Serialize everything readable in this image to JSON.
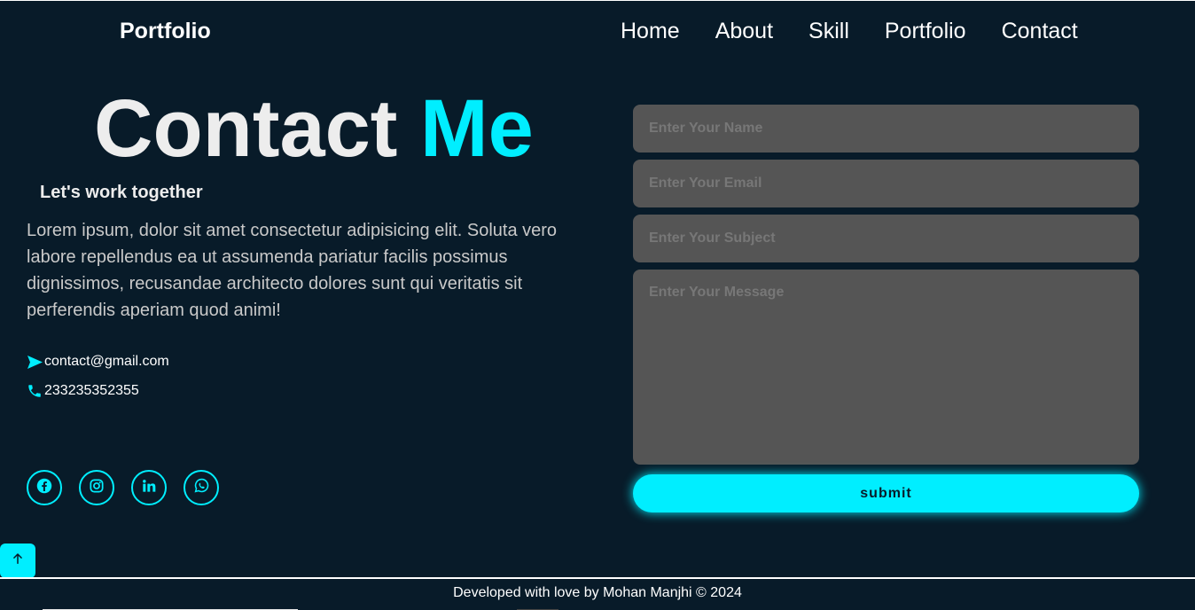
{
  "header": {
    "logo": "Portfolio",
    "nav": [
      "Home",
      "About",
      "Skill",
      "Portfolio",
      "Contact"
    ]
  },
  "contact": {
    "heading_main": "Contact",
    "heading_accent": "Me",
    "subheading": "Let's work together",
    "description": "Lorem ipsum, dolor sit amet consectetur adipisicing elit. Soluta vero labore repellendus ea ut assumenda pariatur facilis possimus dignissimos, recusandae architecto dolores sunt qui veritatis sit perferendis aperiam quod animi!",
    "email": "contact@gmail.com",
    "phone": "233235352355",
    "socials": [
      "facebook-icon",
      "instagram-icon",
      "linkedin-icon",
      "whatsapp-icon"
    ]
  },
  "form": {
    "name_placeholder": "Enter Your Name",
    "email_placeholder": "Enter Your Email",
    "subject_placeholder": "Enter Your Subject",
    "message_placeholder": "Enter Your Message",
    "submit_label": "submit"
  },
  "footer": {
    "text": "Developed with love by Mohan Manjhi © 2024"
  },
  "colors": {
    "background": "#081b29",
    "accent": "#00eeff",
    "field_bg": "#555555"
  }
}
